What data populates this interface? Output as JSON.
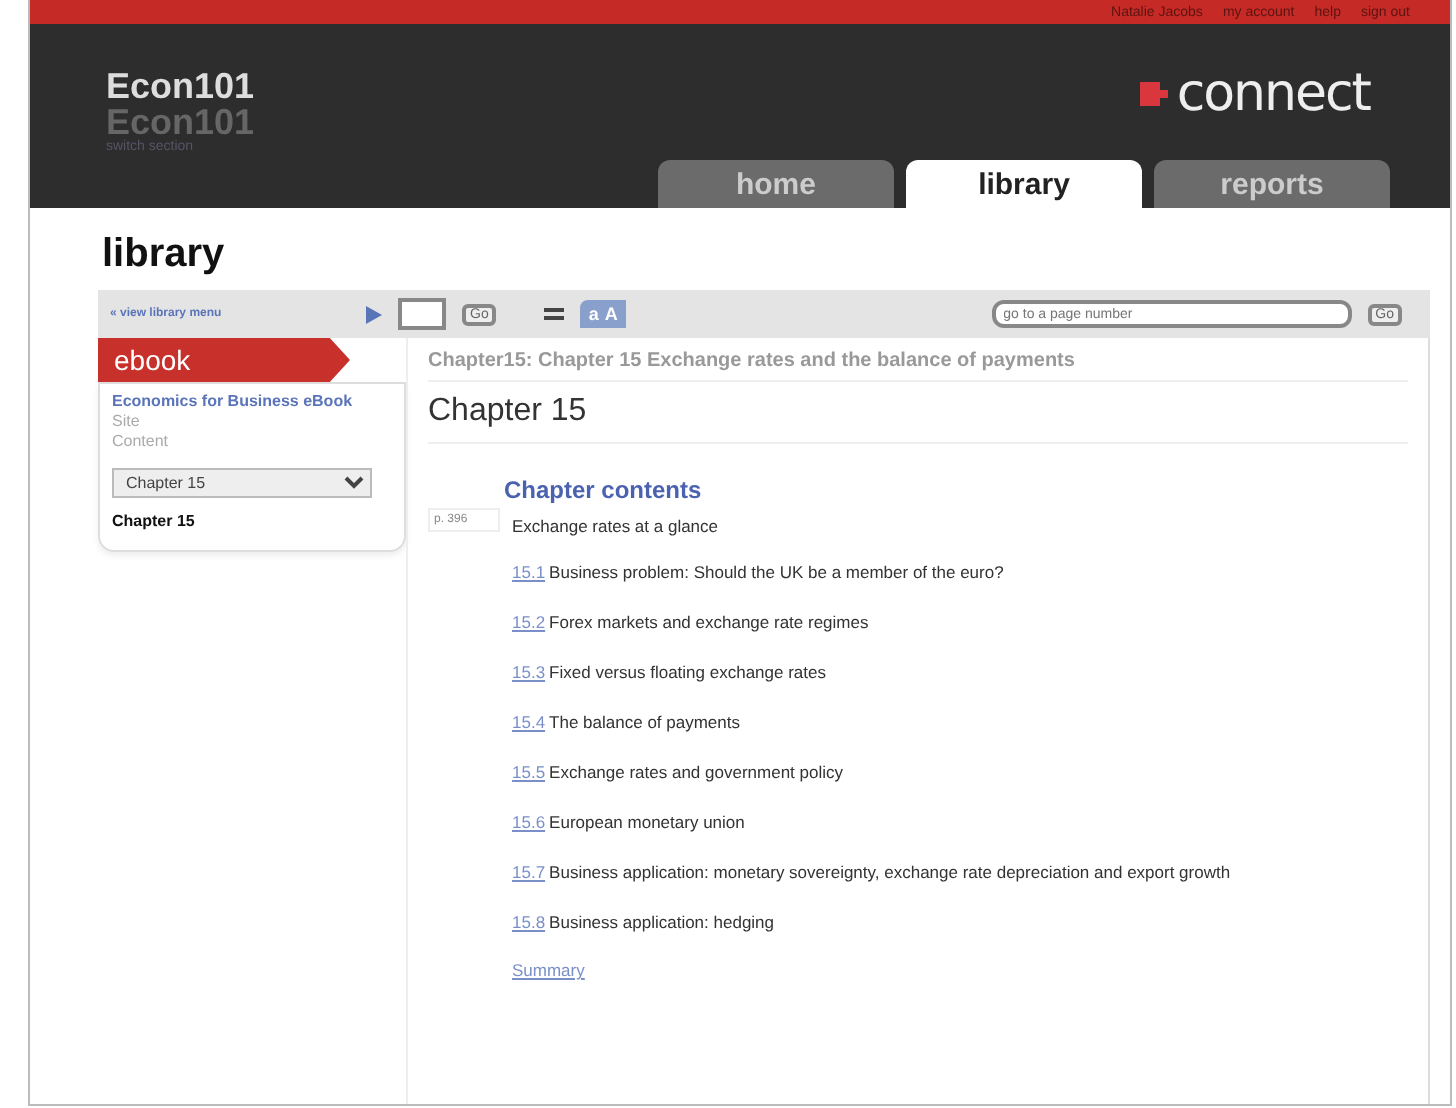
{
  "top_links": [
    "Natalie Jacobs",
    "my account",
    "help",
    "sign out"
  ],
  "course": {
    "title": "Econ101",
    "subtitle": "Econ101",
    "switch_link": "switch section"
  },
  "brand": "connect",
  "tabs": [
    {
      "label": "home",
      "selected": false
    },
    {
      "label": "library",
      "selected": true
    },
    {
      "label": "reports",
      "selected": false
    }
  ],
  "page_title": "library",
  "sidebar": {
    "view_link": "« view library menu",
    "section": "ebook",
    "book_title": "Economics for Business eBook",
    "items": [
      "Site",
      "Content"
    ],
    "chapter_select": "Chapter 15",
    "current": "Chapter 15"
  },
  "toolbar": {
    "go_label": "Go",
    "font_sizes": [
      "a",
      "A"
    ],
    "search": {
      "placeholder": "go to a page number"
    },
    "search_go": "Go"
  },
  "breadcrumb": "Chapter15: Chapter 15 Exchange rates and the balance of payments",
  "chapter_heading": "Chapter 15",
  "contents_heading": "Chapter contents",
  "page_marker": "p. 396",
  "intro": "Exchange rates at a glance",
  "sections": [
    {
      "number": "15.1",
      "title": "Business problem: Should the UK be a member of the euro?"
    },
    {
      "number": "15.2",
      "title": "Forex markets and exchange rate regimes"
    },
    {
      "number": "15.3",
      "title": "Fixed versus floating exchange rates"
    },
    {
      "number": "15.4",
      "title": "The balance of payments"
    },
    {
      "number": "15.5",
      "title": "Exchange rates and government policy"
    },
    {
      "number": "15.6",
      "title": "European monetary union"
    },
    {
      "number": "15.7",
      "title": "Business application: monetary sovereignty, exchange rate depreciation and export growth"
    },
    {
      "number": "15.8",
      "title": "Business application: hedging"
    }
  ],
  "summary_link": "Summary"
}
